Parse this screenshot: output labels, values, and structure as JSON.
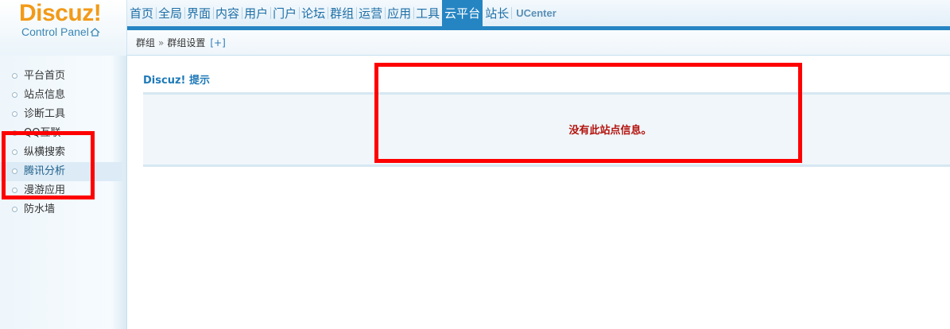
{
  "logo": {
    "brand": "Discuz!",
    "subtitle": "Control Panel",
    "icon": "home-icon"
  },
  "nav": {
    "items": [
      {
        "label": "首页"
      },
      {
        "label": "全局"
      },
      {
        "label": "界面"
      },
      {
        "label": "内容"
      },
      {
        "label": "用户"
      },
      {
        "label": "门户"
      },
      {
        "label": "论坛"
      },
      {
        "label": "群组"
      },
      {
        "label": "运营"
      },
      {
        "label": "应用"
      },
      {
        "label": "工具"
      },
      {
        "label": "云平台",
        "active": true
      },
      {
        "label": "站长"
      },
      {
        "label": "UCenter"
      }
    ]
  },
  "breadcrumb": {
    "first": "群组",
    "separator": "»",
    "second": "群组设置",
    "add": "[+]"
  },
  "sidebar": {
    "items": [
      {
        "label": "平台首页"
      },
      {
        "label": "站点信息"
      },
      {
        "label": "诊断工具"
      },
      {
        "label": "QQ互联"
      },
      {
        "label": "纵横搜索"
      },
      {
        "label": "腾讯分析",
        "active": true
      },
      {
        "label": "漫游应用"
      },
      {
        "label": "防水墙"
      }
    ]
  },
  "main": {
    "title": "Discuz! 提示",
    "message": "没有此站点信息。"
  },
  "colors": {
    "accent": "#2585c3",
    "brand": "#f29a18",
    "error": "#b4120c",
    "annotation": "#ff0000"
  }
}
